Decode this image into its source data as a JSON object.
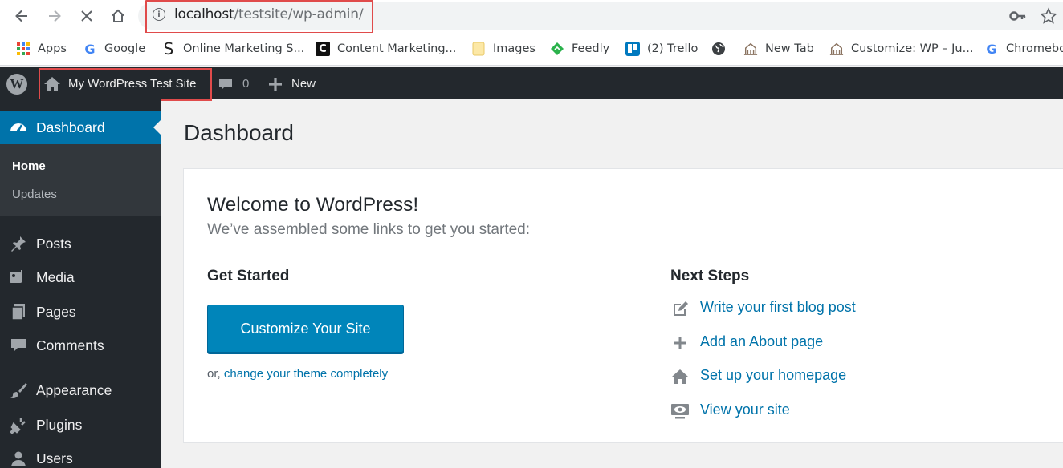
{
  "browser": {
    "url_host": "localhost",
    "url_path": "/testsite/wp-admin/",
    "bookmarks": [
      {
        "label": "Apps",
        "icon": "apps-grid-icon"
      },
      {
        "label": "Google",
        "icon": "google-icon"
      },
      {
        "label": "Online Marketing S...",
        "icon": "s-logo-icon"
      },
      {
        "label": "Content Marketing...",
        "icon": "c-logo-icon"
      },
      {
        "label": "Images",
        "icon": "folder-icon"
      },
      {
        "label": "Feedly",
        "icon": "feedly-icon"
      },
      {
        "label": "(2) Trello",
        "icon": "trello-icon"
      },
      {
        "label": "",
        "icon": "globe-icon"
      },
      {
        "label": "New Tab",
        "icon": "building-icon"
      },
      {
        "label": "Customize: WP – Ju...",
        "icon": "building-icon"
      },
      {
        "label": "Chromebo",
        "icon": "google-icon"
      }
    ]
  },
  "adminbar": {
    "site_name": "My WordPress Test Site",
    "comment_count": "0",
    "new_label": "New"
  },
  "sidebar": {
    "current": {
      "label": "Dashboard",
      "icon": "dashboard-gauge-icon"
    },
    "submenu": [
      "Home",
      "Updates"
    ],
    "items": [
      {
        "label": "Posts",
        "icon": "pin-icon"
      },
      {
        "label": "Media",
        "icon": "media-icon"
      },
      {
        "label": "Pages",
        "icon": "pages-icon"
      },
      {
        "label": "Comments",
        "icon": "comment-icon"
      },
      {
        "label": "Appearance",
        "icon": "brush-icon"
      },
      {
        "label": "Plugins",
        "icon": "plug-icon"
      },
      {
        "label": "Users",
        "icon": "user-icon"
      }
    ]
  },
  "main": {
    "page_title": "Dashboard",
    "welcome_title": "Welcome to WordPress!",
    "welcome_sub": "We’ve assembled some links to get you started:",
    "get_started_title": "Get Started",
    "customize_button": "Customize Your Site",
    "theme_prefix": "or,",
    "theme_link": "change your theme completely",
    "next_steps_title": "Next Steps",
    "next_steps": [
      {
        "label": "Write your first blog post",
        "icon": "edit-icon"
      },
      {
        "label": "Add an About page",
        "icon": "plus-icon"
      },
      {
        "label": "Set up your homepage",
        "icon": "home-icon"
      },
      {
        "label": "View your site",
        "icon": "view-site-icon"
      }
    ]
  },
  "colors": {
    "accent": "#0073aa",
    "button": "#0085ba",
    "adminbar": "#23282d",
    "highlight_box": "#e04b4b"
  }
}
